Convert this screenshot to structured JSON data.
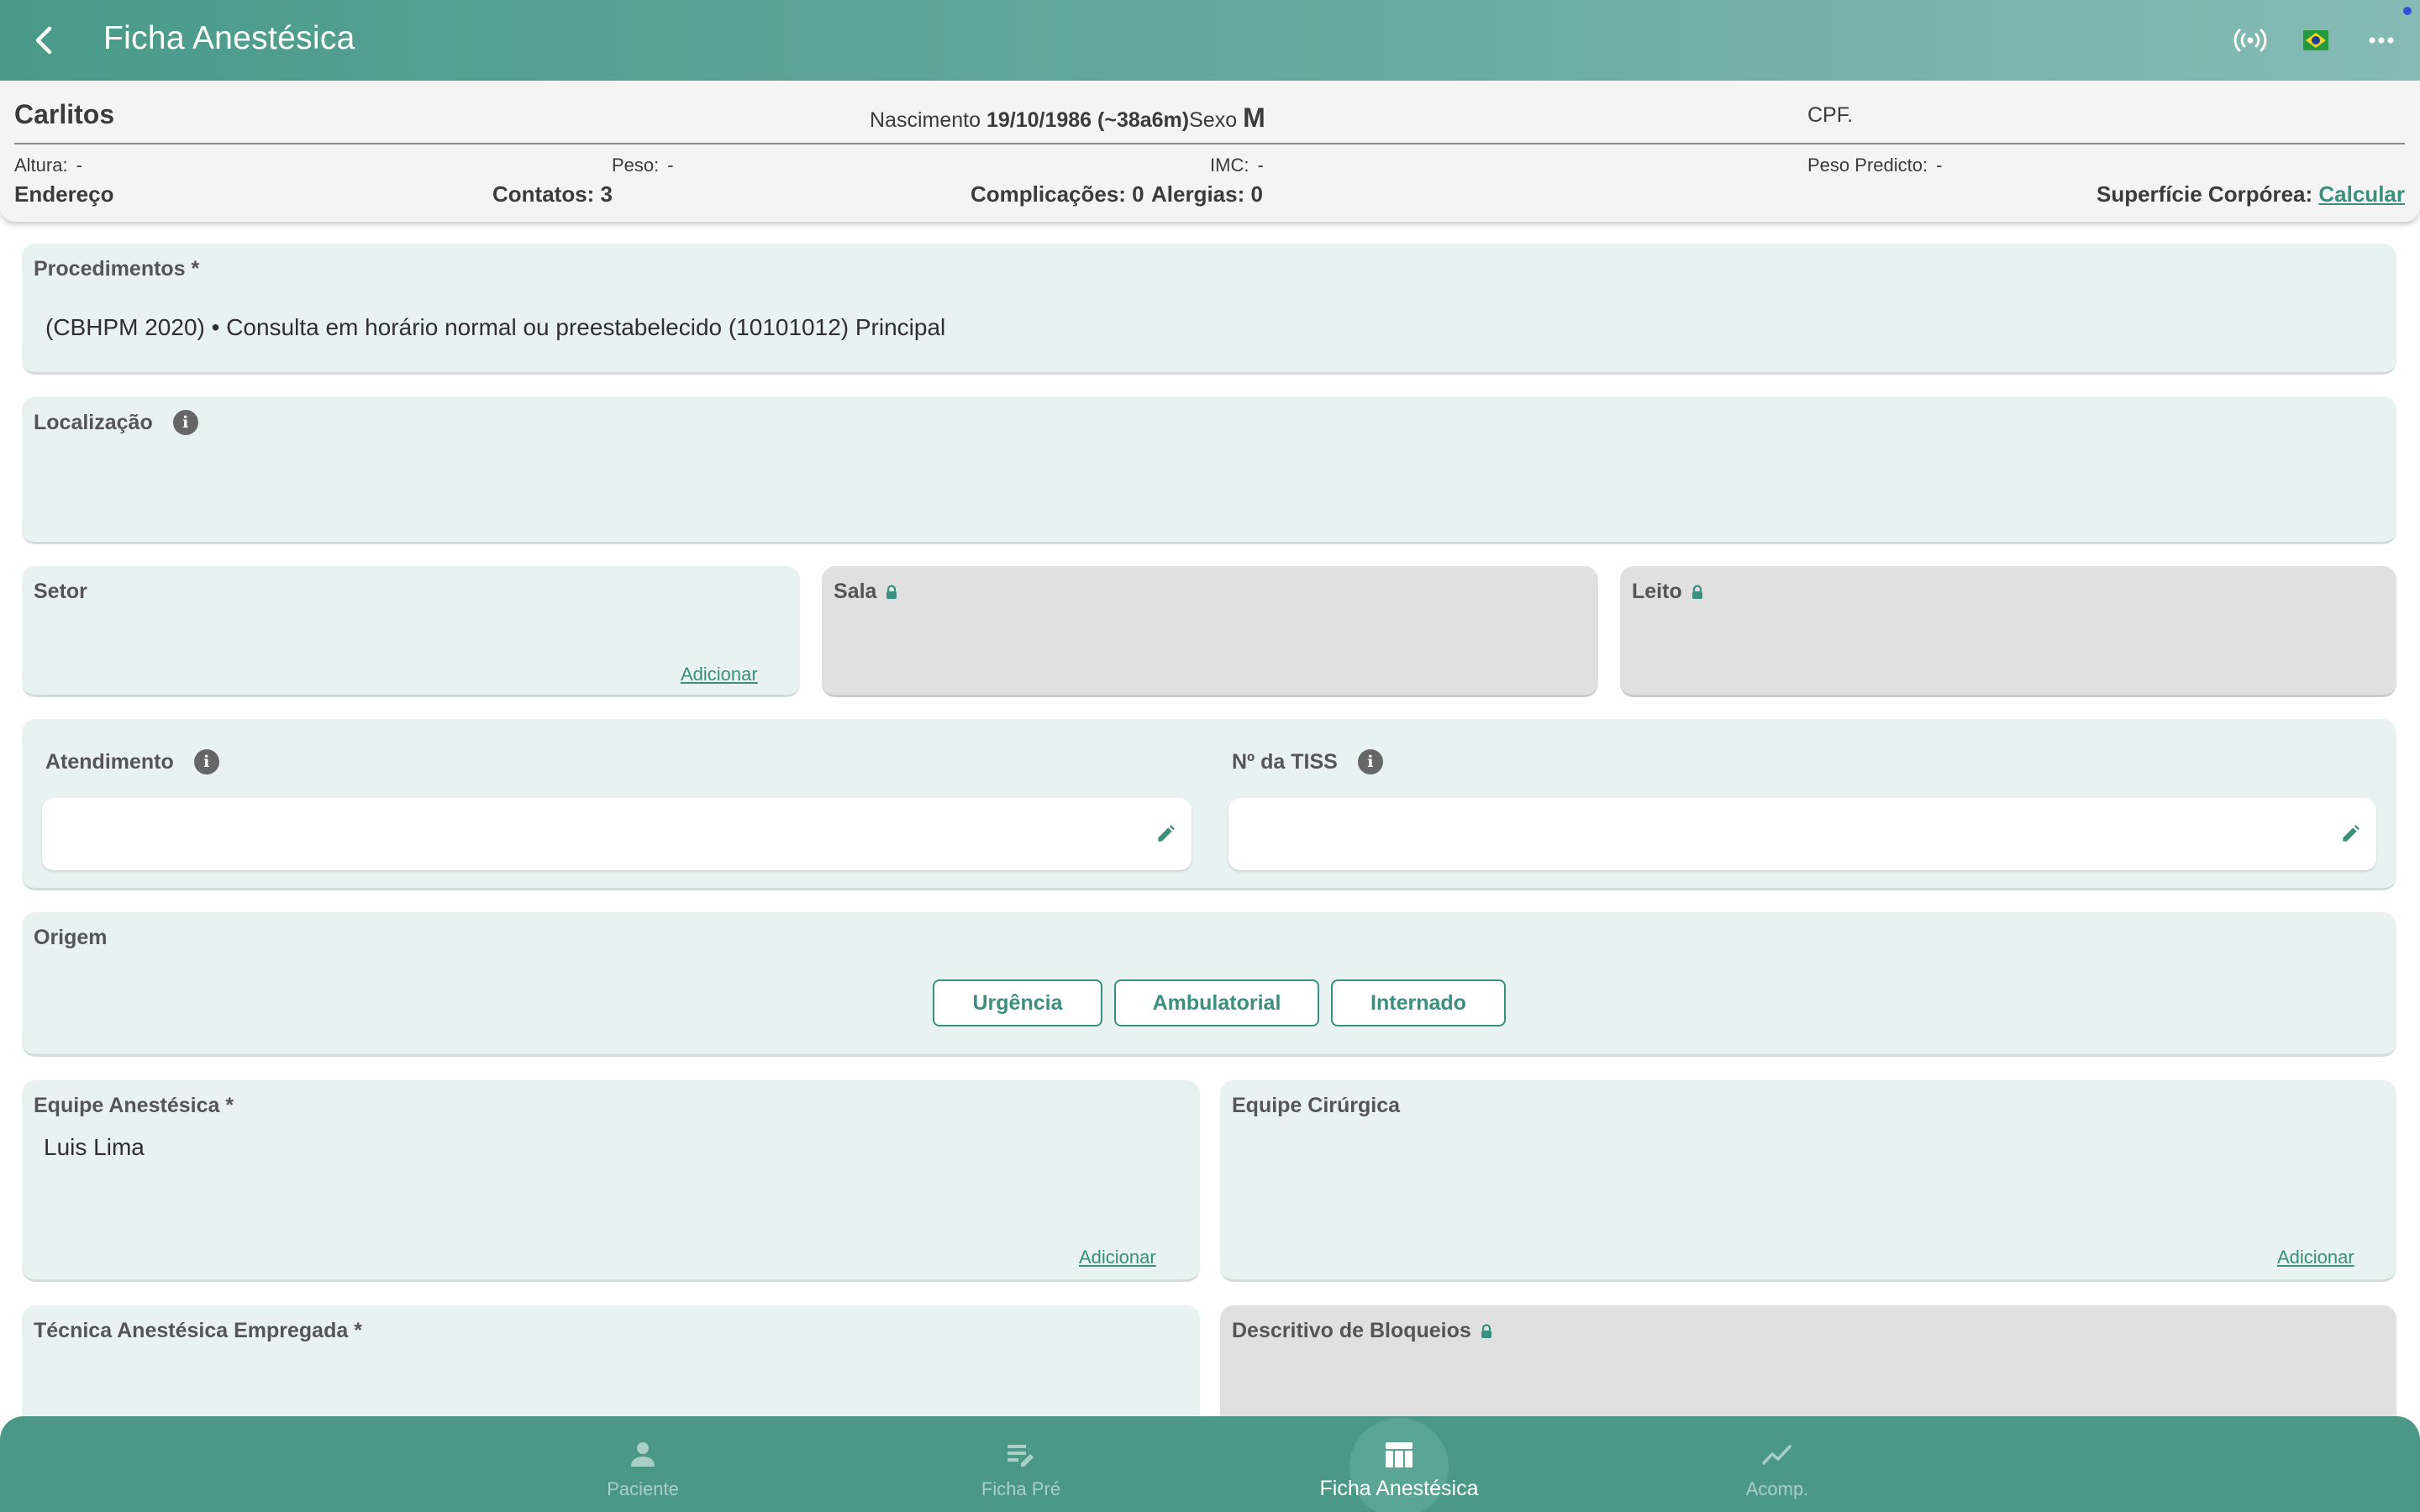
{
  "appbar": {
    "title": "Ficha Anestésica",
    "icons": [
      "back-arrow-icon",
      "broadcast-icon",
      "brazil-flag-icon",
      "more-icon"
    ]
  },
  "patient": {
    "name": "Carlitos",
    "birth_label": "Nascimento",
    "birth_value": "19/10/1986 (~38a6m)",
    "sex_label": "Sexo",
    "sex_value": "M",
    "cpf_label": "CPF.",
    "height_label": "Altura:",
    "height_value": "-",
    "weight_label": "Peso:",
    "weight_value": "-",
    "bmi_label": "IMC:",
    "bmi_value": "-",
    "predicted_weight_label": "Peso Predicto:",
    "predicted_weight_value": "-",
    "address_label": "Endereço",
    "contacts_label": "Contatos: 3",
    "complications_label": "Complicações: 0",
    "allergies_label": "Alergias: 0",
    "body_surface_label": "Superfície Corpórea:",
    "body_surface_action": "Calcular"
  },
  "form": {
    "procedures": {
      "label": "Procedimentos *",
      "value": "(CBHPM 2020) • Consulta em horário normal ou preestabelecido (10101012) Principal"
    },
    "location": {
      "label": "Localização"
    },
    "sector": {
      "label": "Setor",
      "add_label": "Adicionar"
    },
    "room": {
      "label": "Sala"
    },
    "bed": {
      "label": "Leito"
    },
    "service": {
      "label": "Atendimento",
      "value": ""
    },
    "tiss": {
      "label": "Nº da TISS",
      "value": ""
    },
    "origin": {
      "label": "Origem",
      "options": [
        "Urgência",
        "Ambulatorial",
        "Internado"
      ]
    },
    "anesthetic_team": {
      "label": "Equipe Anestésica *",
      "member": "Luis Lima",
      "add_label": "Adicionar"
    },
    "surgical_team": {
      "label": "Equipe Cirúrgica",
      "add_label": "Adicionar"
    },
    "technique": {
      "label": "Técnica Anestésica Empregada *"
    },
    "blocks": {
      "label": "Descritivo de Bloqueios"
    }
  },
  "bottom_nav": {
    "items": [
      {
        "label": "Paciente",
        "icon": "person-icon",
        "active": false
      },
      {
        "label": "Ficha Pré",
        "icon": "edit-notes-icon",
        "active": false
      },
      {
        "label": "Ficha Anestésica",
        "icon": "table-icon",
        "active": true
      },
      {
        "label": "Acomp.",
        "icon": "trend-icon",
        "active": false
      }
    ]
  },
  "colors": {
    "primary": "#4b9788",
    "card_bg": "#e8f2f0",
    "locked_bg": "#e0e0e0",
    "link": "#3a8f7f"
  }
}
